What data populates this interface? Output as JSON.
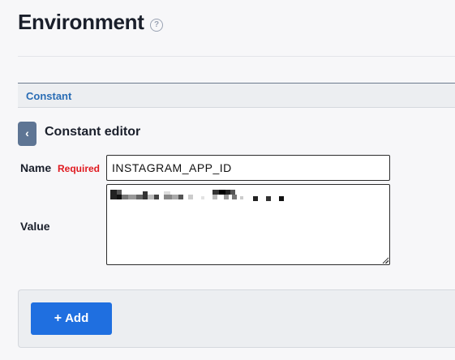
{
  "page": {
    "title": "Environment",
    "help_icon": "question-circle-icon",
    "help_glyph": "?"
  },
  "section": {
    "label": "Constant"
  },
  "editor": {
    "back_icon": "chevron-left-icon",
    "back_glyph": "‹",
    "title": "Constant editor"
  },
  "form": {
    "name_label": "Name",
    "required_label": "Required",
    "name_value": "INSTAGRAM_APP_ID",
    "value_label": "Value",
    "value_redacted": true
  },
  "actions": {
    "add_icon": "plus-icon",
    "add_glyph": "+",
    "add_label": "Add"
  },
  "colors": {
    "accent_blue": "#1f6fe0",
    "section_label": "#2a6db5",
    "required_red": "#e0191f",
    "back_button": "#5e7594"
  }
}
